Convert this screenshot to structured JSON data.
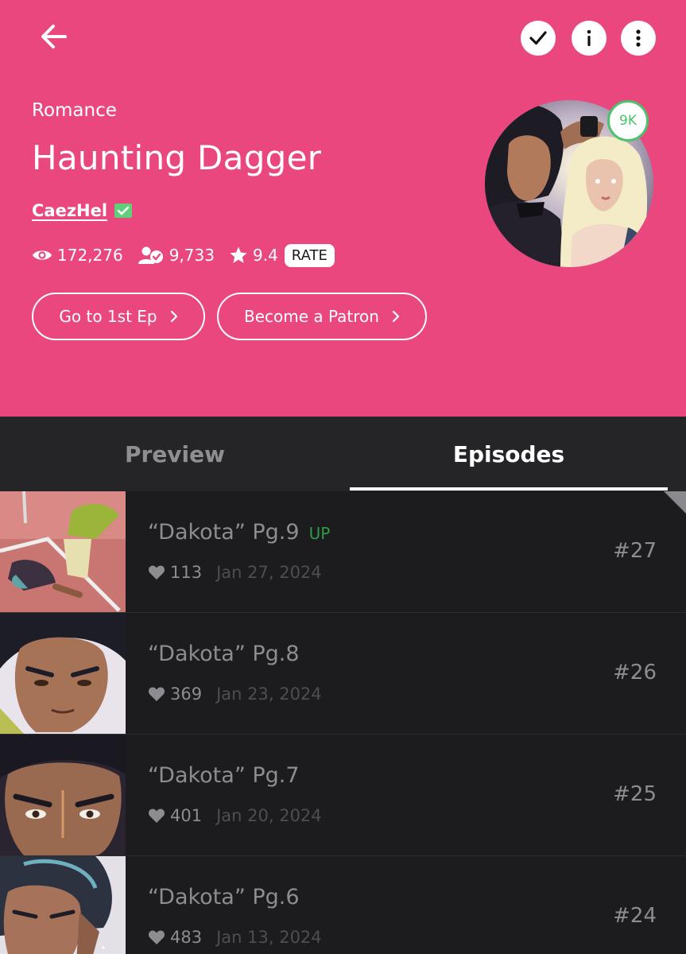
{
  "header": {
    "bg_color": "#e9477e",
    "genre": "Romance",
    "title": "Haunting Dagger",
    "author": "CaezHel",
    "stats": {
      "views": "172,276",
      "subscribers": "9,733",
      "rating": "9.4",
      "rate_label": "RATE"
    },
    "buttons": {
      "first_ep": "Go to 1st Ep",
      "patron": "Become a Patron"
    },
    "subscriber_badge": "9K",
    "icons": {
      "back": "arrow-left-icon",
      "subscribe": "check-icon",
      "info": "info-icon",
      "more": "more-vertical-icon",
      "views": "eye-icon",
      "subscribers": "user-check-icon",
      "rating": "star-icon"
    }
  },
  "tabs": [
    {
      "label": "Preview",
      "active": false
    },
    {
      "label": "Episodes",
      "active": true
    }
  ],
  "episodes": [
    {
      "title": "“Dakota” Pg.9",
      "badge": "UP",
      "likes": "113",
      "date": "Jan 27, 2024",
      "number": "#27"
    },
    {
      "title": "“Dakota” Pg.8",
      "badge": "",
      "likes": "369",
      "date": "Jan 23, 2024",
      "number": "#26"
    },
    {
      "title": "“Dakota” Pg.7",
      "badge": "",
      "likes": "401",
      "date": "Jan 20, 2024",
      "number": "#25"
    },
    {
      "title": "“Dakota” Pg.6",
      "badge": "",
      "likes": "483",
      "date": "Jan 13, 2024",
      "number": "#24"
    }
  ]
}
